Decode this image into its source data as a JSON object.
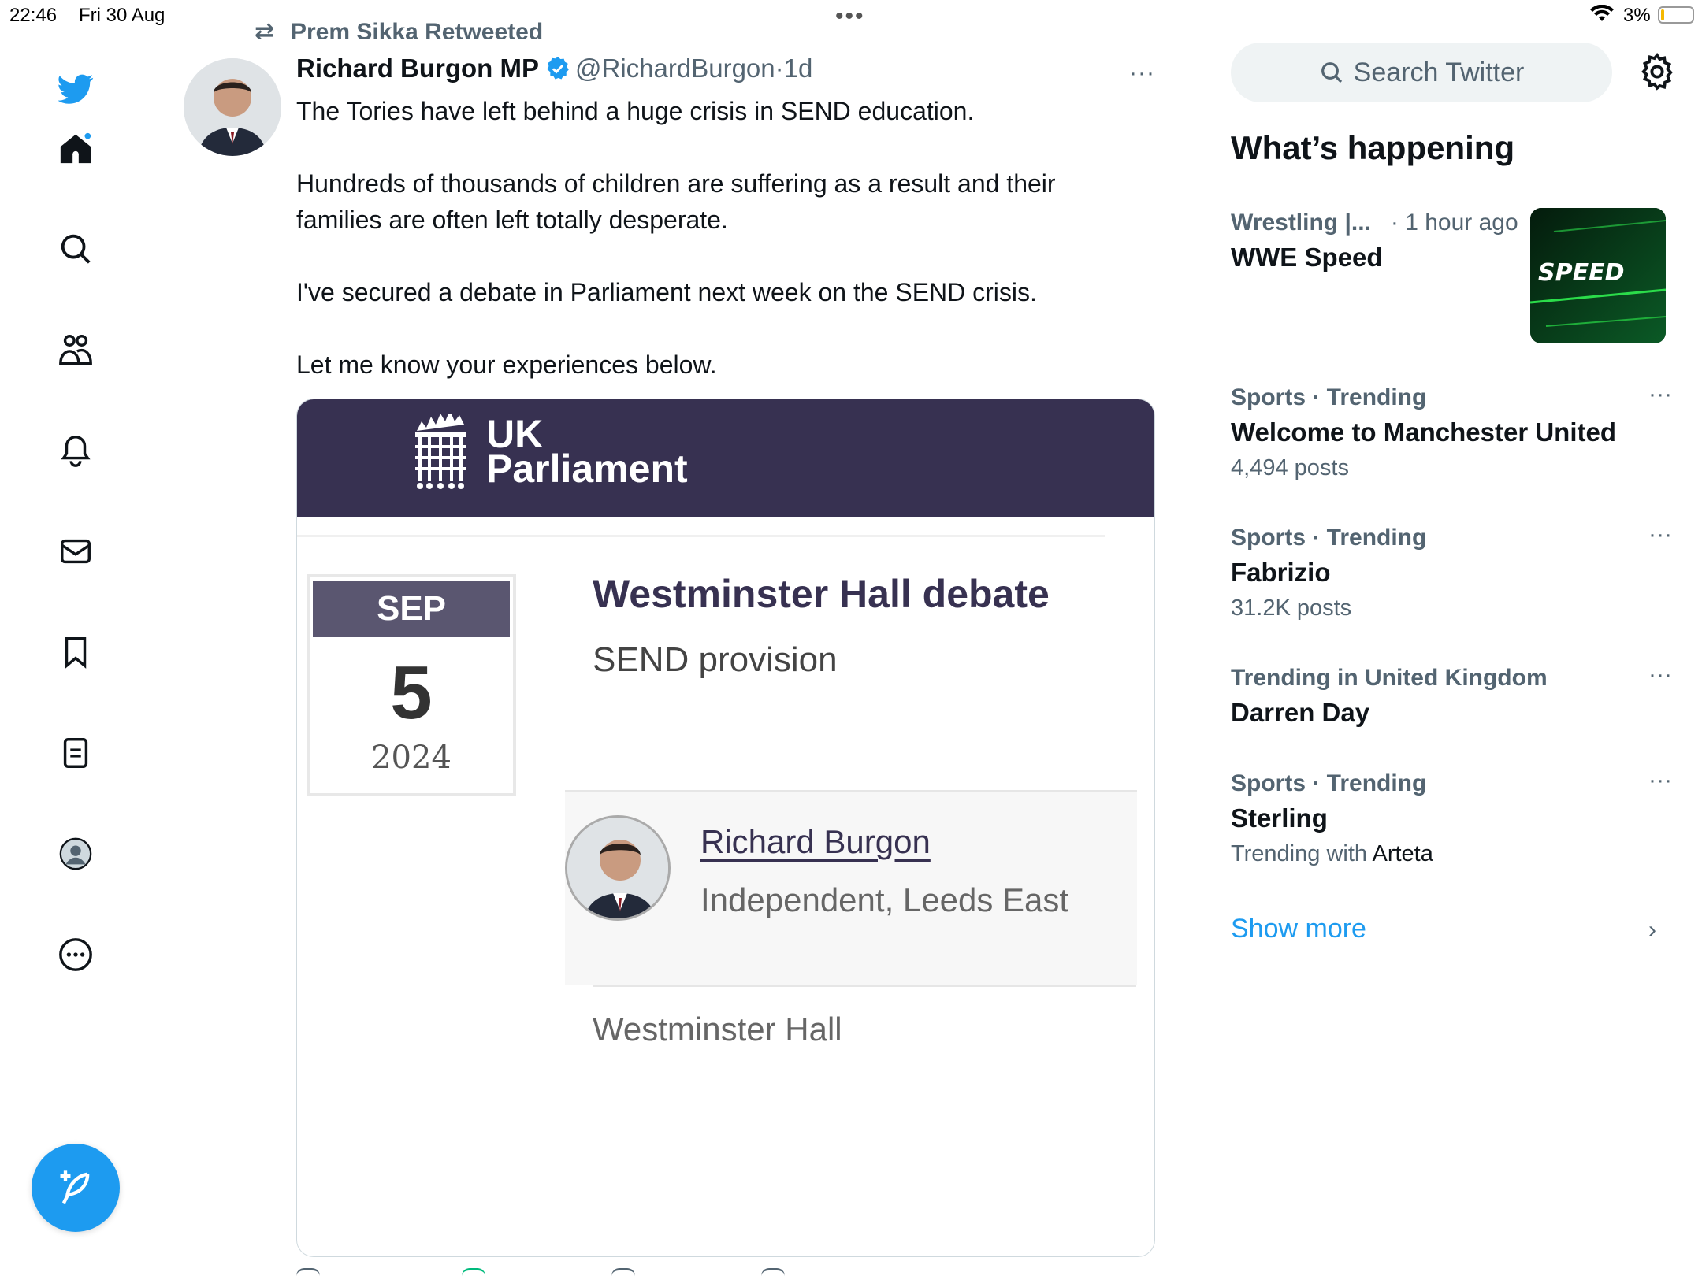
{
  "status": {
    "time": "22:46",
    "date": "Fri 30 Aug",
    "battery": "3%",
    "dots": "•••"
  },
  "nav": {
    "items": [
      "home-icon",
      "search-icon",
      "communities-icon",
      "notifications-icon",
      "messages-icon",
      "bookmarks-icon",
      "lists-icon",
      "profile-icon",
      "more-icon"
    ],
    "compose": "compose-icon",
    "accent": "#1d9bf0"
  },
  "tweet": {
    "retweet_line": "Prem Sikka Retweeted",
    "author_name": "Richard Burgon MP",
    "handle": "@RichardBurgon",
    "separator": "·",
    "time": "1d",
    "more": "···",
    "paragraphs": [
      "The Tories have left behind a huge crisis in SEND education.",
      "Hundreds of thousands of children are suffering as a result and their families are often left totally desperate.",
      "I've secured a debate in Parliament next week on the SEND crisis.",
      "Let me know your experiences below."
    ],
    "card": {
      "banner_line1": "UK",
      "banner_line2": "Parliament",
      "banner_color": "#373151",
      "month": "SEP",
      "day": "5",
      "year": "2024",
      "title": "Westminster Hall debate",
      "subtitle": "SEND provision",
      "member_name": "Richard Burgon",
      "member_party": "Independent, Leeds East",
      "venue": "Westminster Hall"
    }
  },
  "sidebar": {
    "search_placeholder": "Search Twitter",
    "heading": "What’s happening",
    "trends": [
      {
        "category": "Wrestling |...",
        "time": "· 1 hour ago",
        "topic": "WWE Speed",
        "image_label": "SPEED"
      },
      {
        "category": "Sports · Trending",
        "topic": "Welcome to Manchester United",
        "count": "4,494 posts"
      },
      {
        "category": "Sports · Trending",
        "topic": "Fabrizio",
        "count": "31.2K posts"
      },
      {
        "category": "Trending in United Kingdom",
        "topic": "Darren Day"
      },
      {
        "category": "Sports · Trending",
        "topic": "Sterling",
        "count_prefix": "Trending with",
        "count_highlight": "Arteta"
      }
    ],
    "show_more": "Show more",
    "more": "···",
    "chevron": "›"
  }
}
